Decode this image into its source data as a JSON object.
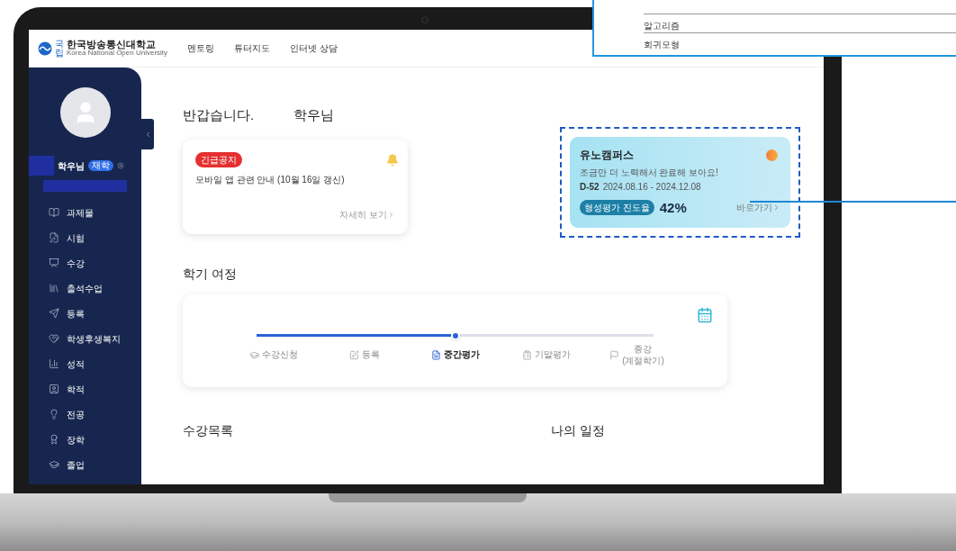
{
  "header": {
    "logo_text": "한국방송통신대학교",
    "logo_mark": "국립",
    "logo_subtext": "Korea National Open University",
    "nav": [
      "멘토링",
      "튜터지도",
      "인터넷 상담"
    ]
  },
  "profile": {
    "name_suffix": "학우님",
    "badge": "재학"
  },
  "menu": [
    "과제물",
    "시험",
    "수강",
    "출석수업",
    "등록",
    "학생후생복지",
    "성적",
    "학적",
    "전공",
    "장학",
    "졸업"
  ],
  "greeting": {
    "hello": "반갑습니다.",
    "suffix": "학우님"
  },
  "notice": {
    "badge": "긴급공지",
    "title": "모바일 앱 관련 안내 (10월 16일 갱신)",
    "link": "자세히 보기"
  },
  "course_card": {
    "title": "유노캠퍼스",
    "subtitle": "조금만 더 노력해서 완료해 보아요!",
    "dday": "D-52",
    "period": "2024.08.16 - 2024.12.08",
    "progress_label": "형성평가 진도율",
    "progress": "42%",
    "link": "바로가기"
  },
  "journey": {
    "title": "학기 여정",
    "level": 0.5,
    "steps": [
      {
        "label": "수강신청",
        "selected": false
      },
      {
        "label": "등록",
        "selected": false
      },
      {
        "label": "중간평가",
        "selected": true
      },
      {
        "label": "기말평가",
        "selected": false
      },
      {
        "label": "종강",
        "sub": "(계절학기)",
        "selected": false
      }
    ]
  },
  "sections": [
    "수강목록",
    "나의 일정"
  ],
  "popup": {
    "items": [
      "알고리즘",
      "회귀모형"
    ]
  }
}
